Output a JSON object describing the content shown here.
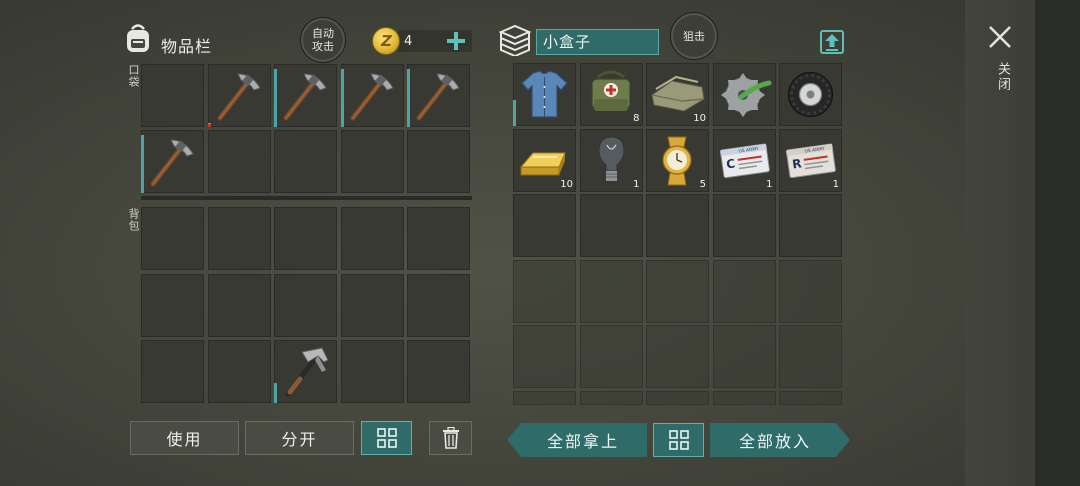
{
  "inventory": {
    "title": "物品栏",
    "auto_attack_label": "自动\n攻击",
    "coins": "4",
    "pocket_label": "口袋",
    "backpack_label": "背包",
    "pocket_slots": [
      {
        "item": "",
        "qty": ""
      },
      {
        "item": "pickaxe",
        "qty": ""
      },
      {
        "item": "pickaxe",
        "qty": ""
      },
      {
        "item": "pickaxe",
        "qty": ""
      },
      {
        "item": "pickaxe",
        "qty": ""
      },
      {
        "item": "pickaxe",
        "qty": ""
      },
      {
        "item": "",
        "qty": ""
      },
      {
        "item": "",
        "qty": ""
      },
      {
        "item": "",
        "qty": ""
      },
      {
        "item": "",
        "qty": ""
      }
    ],
    "backpack_slots": [
      {
        "item": "",
        "qty": ""
      },
      {
        "item": "",
        "qty": ""
      },
      {
        "item": "",
        "qty": ""
      },
      {
        "item": "",
        "qty": ""
      },
      {
        "item": "",
        "qty": ""
      },
      {
        "item": "",
        "qty": ""
      },
      {
        "item": "",
        "qty": ""
      },
      {
        "item": "",
        "qty": ""
      },
      {
        "item": "",
        "qty": ""
      },
      {
        "item": "",
        "qty": ""
      },
      {
        "item": "",
        "qty": ""
      },
      {
        "item": "",
        "qty": ""
      },
      {
        "item": "hammer",
        "qty": ""
      },
      {
        "item": "",
        "qty": ""
      },
      {
        "item": "",
        "qty": ""
      }
    ],
    "use_button": "使用",
    "split_button": "分开",
    "sort_icon": "grid-sort-icon",
    "trash_icon": "trash-icon"
  },
  "container": {
    "name": "小盒子",
    "snipe_label": "狙击",
    "upload_icon": "upload-icon",
    "slots": [
      {
        "item": "shirt",
        "qty": ""
      },
      {
        "item": "medkit-bag",
        "qty": "8"
      },
      {
        "item": "cloth",
        "qty": "10"
      },
      {
        "item": "saw-blade",
        "qty": ""
      },
      {
        "item": "tire",
        "qty": ""
      },
      {
        "item": "gold-bar",
        "qty": "10"
      },
      {
        "item": "light-bulb",
        "qty": "1"
      },
      {
        "item": "gold-watch",
        "qty": "5"
      },
      {
        "item": "id-card-c",
        "qty": "1"
      },
      {
        "item": "id-card-r",
        "qty": "1"
      }
    ],
    "take_all_button": "全部拿上",
    "put_all_button": "全部放入"
  },
  "close_label": "关闭",
  "card_text": "US ARMY",
  "card_letters": [
    "C",
    "R"
  ],
  "colors": {
    "accent_teal": "#2f6b68",
    "durability_bar": "#4ea3a6",
    "coin_gold": "#e2b93a"
  }
}
